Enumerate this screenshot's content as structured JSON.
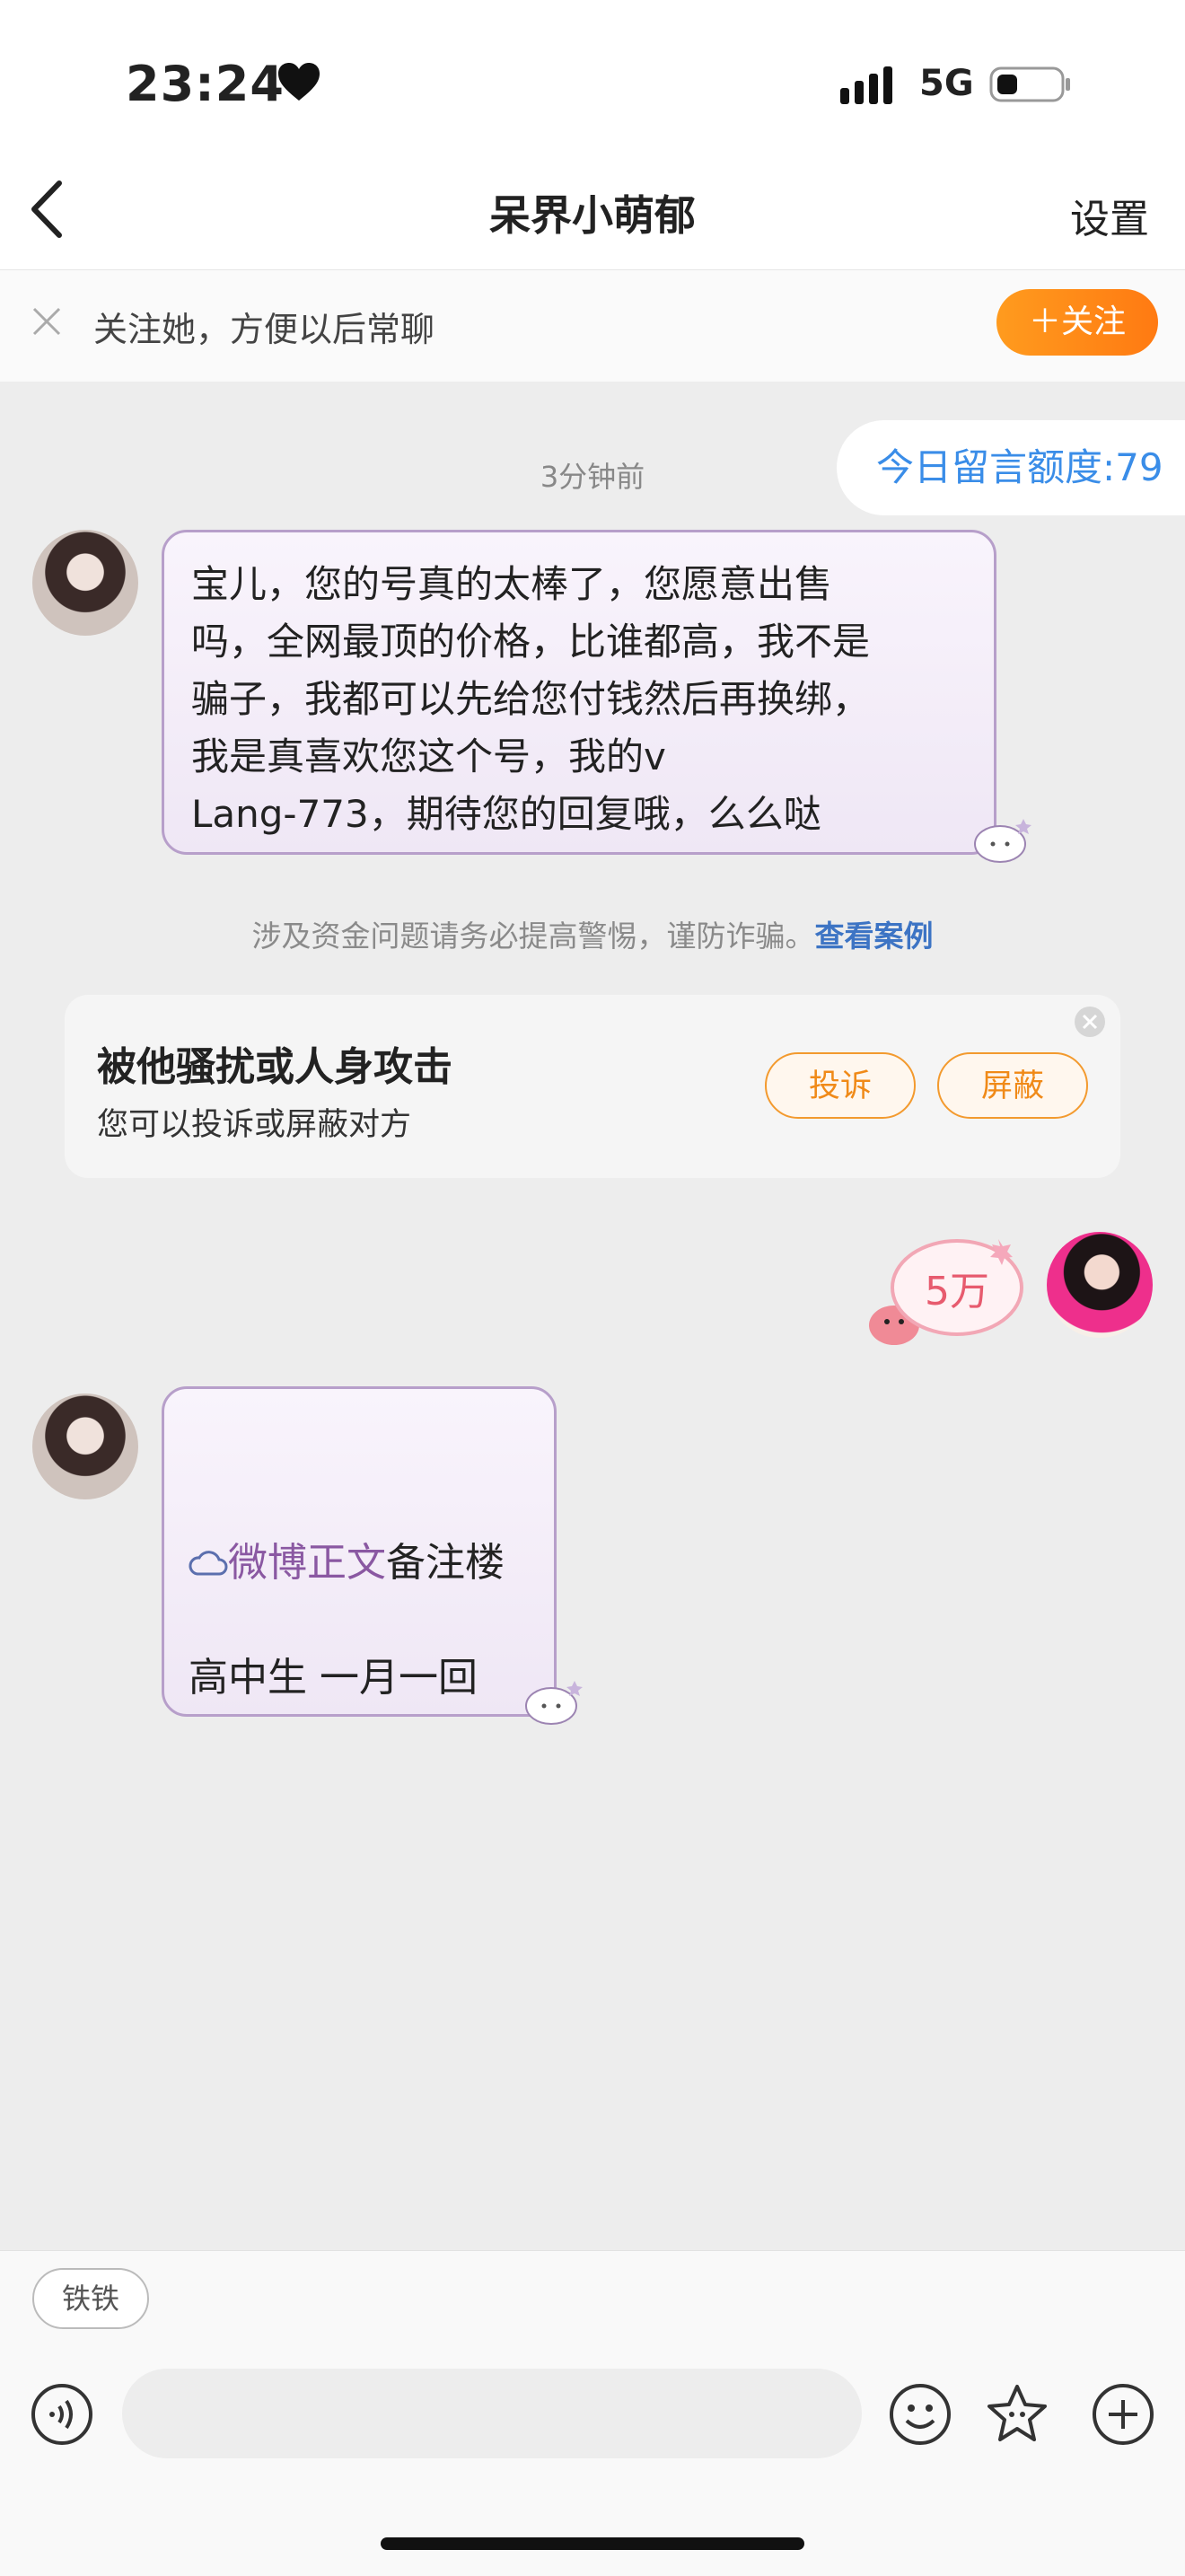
{
  "status": {
    "time": "23:24",
    "network": "5G"
  },
  "nav": {
    "title": "呆界小萌郁",
    "settings": "设置"
  },
  "follow_bar": {
    "text": "关注她，方便以后常聊",
    "button": "＋关注"
  },
  "quota": "今日留言额度:79",
  "chat": {
    "time_ago": "3分钟前",
    "message1_lines": [
      "宝儿，您的号真的太棒了，您愿意出售",
      "吗，全网最顶的价格，比谁都高，我不是",
      "骗子，我都可以先给您付钱然后再换绑，",
      "我是真喜欢您这个号，我的v",
      "Lang-773，期待您的回复哦，么么哒"
    ],
    "warning": "涉及资金问题请务必提高警惕，谨防诈骗。",
    "warning_link": "查看案例",
    "report": {
      "title": "被他骚扰或人身攻击",
      "subtitle": "您可以投诉或屏蔽对方",
      "complain": "投诉",
      "block": "屏蔽"
    },
    "my_sticker_text": "5万",
    "message2": {
      "highlight": "微博正文",
      "rest": "备注楼",
      "line2": "高中生 一月一回"
    }
  },
  "input": {
    "chip": "铁铁"
  },
  "icons": [
    "heart-icon",
    "signal-icon",
    "battery-icon",
    "back-icon",
    "close-icon",
    "voice-icon",
    "emoji-icon",
    "sticker-icon",
    "plus-icon",
    "cloud-icon"
  ]
}
